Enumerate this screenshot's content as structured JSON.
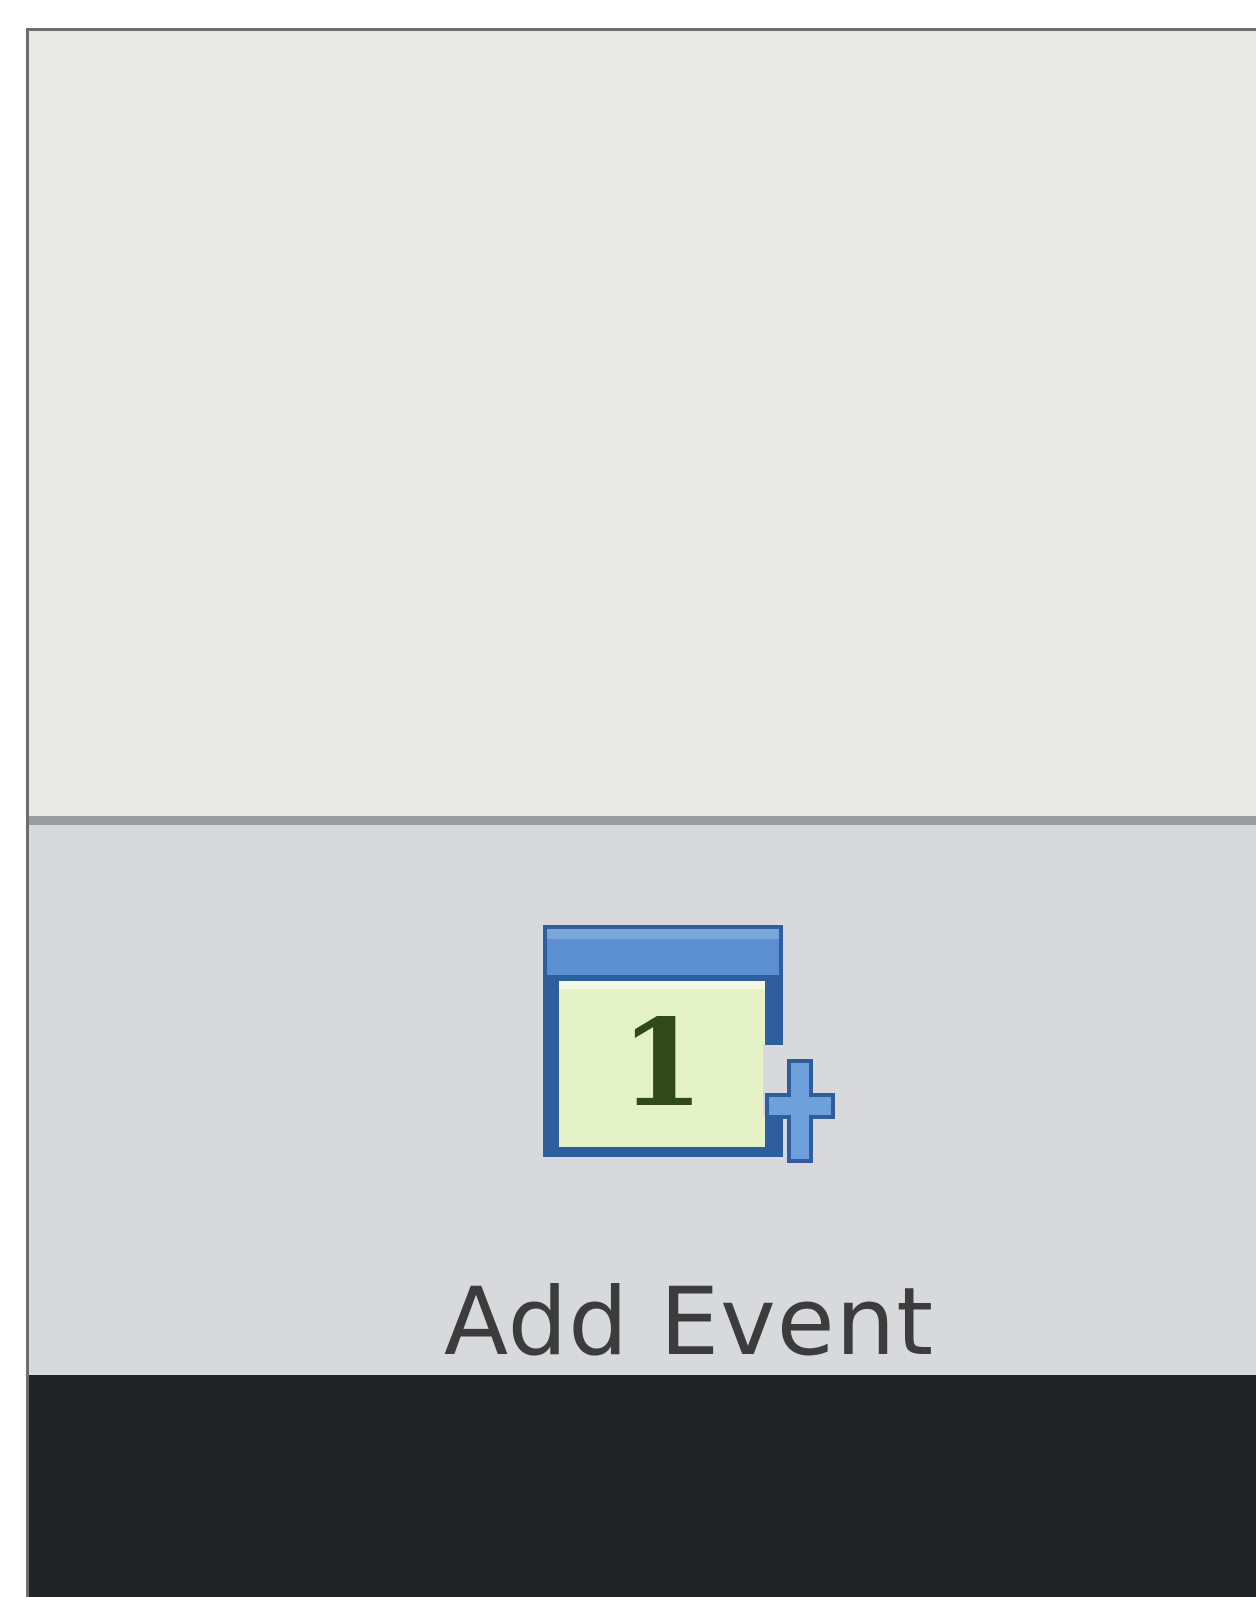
{
  "ribbon": {
    "add_event": {
      "label": "Add Event",
      "icon": "calendar-add-icon",
      "day_number": "1"
    }
  },
  "colors": {
    "content_bg": "#e9e9e7",
    "ribbon_bg": "#d7d9dc",
    "divider": "#9c9d9f",
    "bottom_bar": "#212326",
    "calendar_blue": "#5b8fd0",
    "calendar_page": "#e4f2c6",
    "calendar_digit": "#2f4a18"
  }
}
